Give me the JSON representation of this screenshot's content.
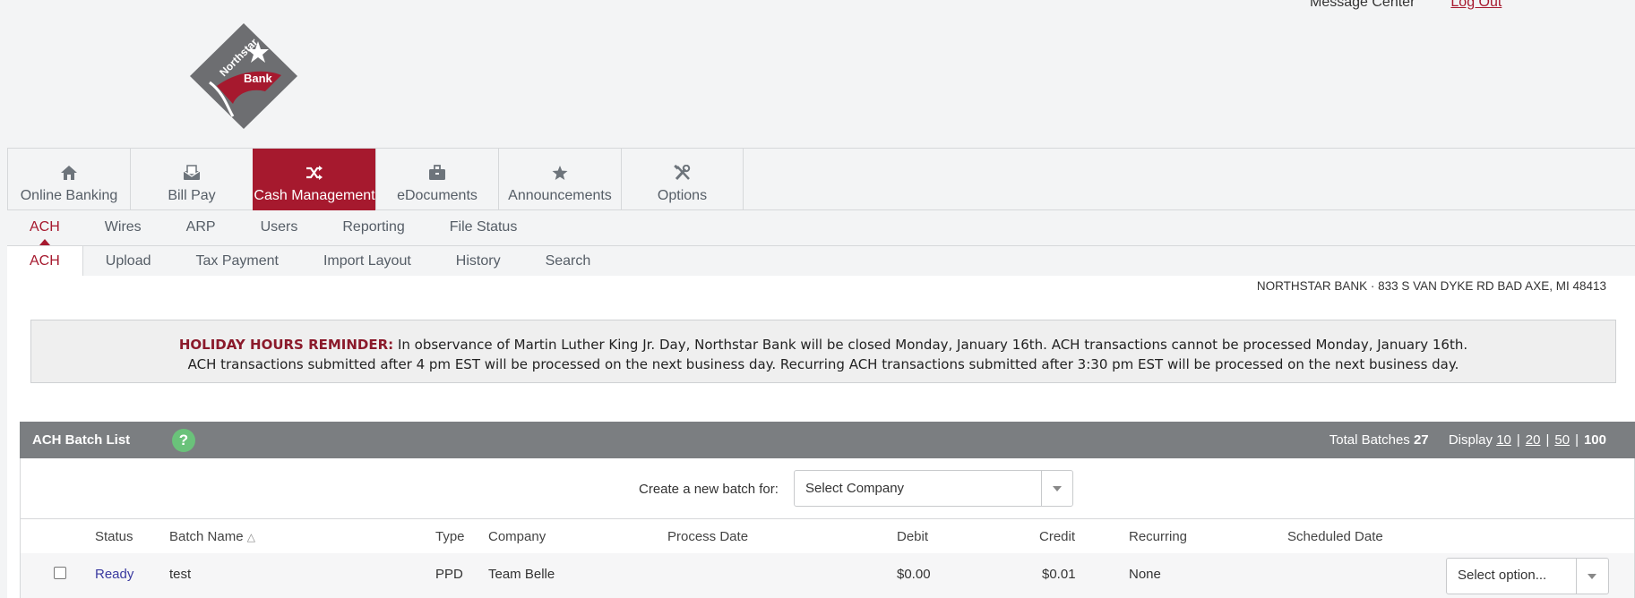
{
  "header": {
    "message_center": "Message Center",
    "logout": "Log Out",
    "logo": {
      "line1": "Northstar",
      "line2": "Bank",
      "colors": {
        "red": "#a6192e",
        "gray": "#6d6e71"
      }
    }
  },
  "main_nav": [
    {
      "label": "Online Banking",
      "icon": "home-icon"
    },
    {
      "label": "Bill Pay",
      "icon": "bill-icon"
    },
    {
      "label": "Cash Management",
      "icon": "shuffle-icon",
      "active": true
    },
    {
      "label": "eDocuments",
      "icon": "briefcase-icon"
    },
    {
      "label": "Announcements",
      "icon": "star-icon"
    },
    {
      "label": "Options",
      "icon": "tools-icon"
    }
  ],
  "sub_nav": [
    "ACH",
    "Wires",
    "ARP",
    "Users",
    "Reporting",
    "File Status"
  ],
  "sub_nav2": [
    "ACH",
    "Upload",
    "Tax Payment",
    "Import Layout",
    "History",
    "Search"
  ],
  "address": "NORTHSTAR BANK · 833 S VAN DYKE RD BAD AXE, MI 48413",
  "reminder": {
    "label": "HOLIDAY HOURS REMINDER:",
    "line1": "In observance of Martin Luther King Jr. Day, Northstar Bank will be closed Monday, January 16th. ACH transactions cannot be processed Monday, January 16th.",
    "line2": "ACH transactions submitted after 4 pm EST will be processed on the next business day. Recurring ACH transactions submitted after 3:30 pm EST will be processed on the next business day."
  },
  "batch_list": {
    "title": "ACH Batch List",
    "help": "?",
    "total_label": "Total Batches",
    "total_value": "27",
    "display_label": "Display",
    "page_sizes": [
      "10",
      "20",
      "50",
      "100"
    ],
    "create_label": "Create a new batch for:",
    "company_select": "Select Company",
    "columns": {
      "status": "Status",
      "batch_name": "Batch Name",
      "type": "Type",
      "company": "Company",
      "process_date": "Process Date",
      "debit": "Debit",
      "credit": "Credit",
      "recurring": "Recurring",
      "scheduled_date": "Scheduled Date"
    },
    "rows": [
      {
        "status": "Ready",
        "batch_name": "test",
        "type": "PPD",
        "company": "Team Belle",
        "process_date": "",
        "debit": "$0.00",
        "credit": "$0.01",
        "recurring": "None",
        "scheduled_date": "",
        "action": "Select option..."
      }
    ]
  }
}
